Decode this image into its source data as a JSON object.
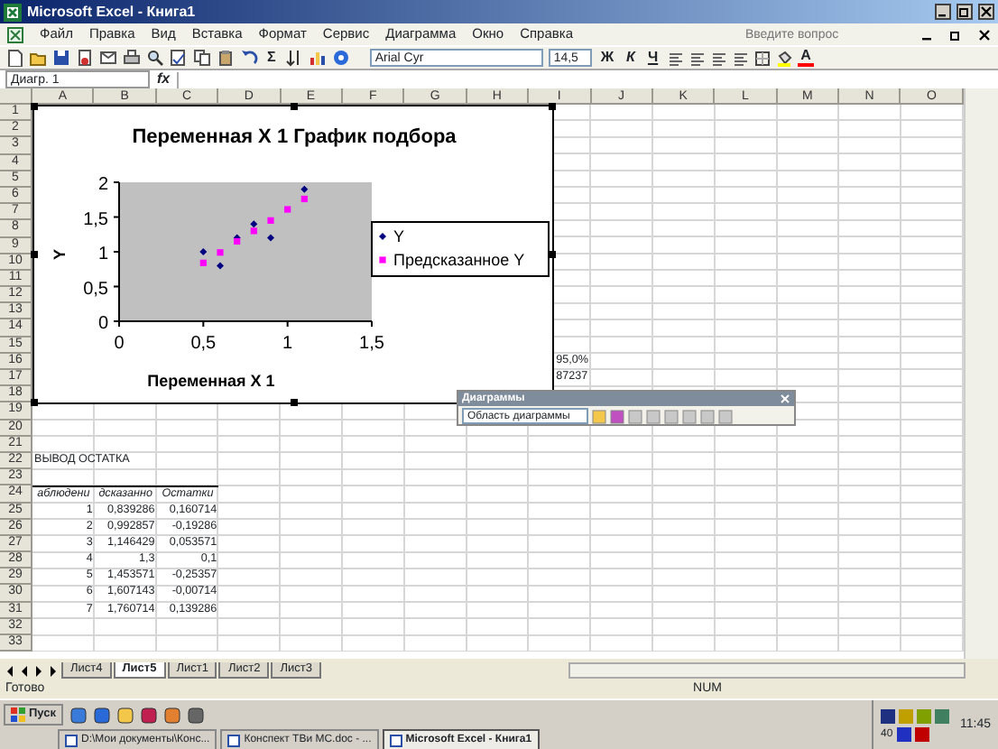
{
  "window": {
    "title": "Microsoft Excel - Книга1"
  },
  "menu": [
    {
      "label": "Файл"
    },
    {
      "label": "Правка"
    },
    {
      "label": "Вид"
    },
    {
      "label": "Вставка"
    },
    {
      "label": "Формат"
    },
    {
      "label": "Сервис"
    },
    {
      "label": "Диаграмма"
    },
    {
      "label": "Окно"
    },
    {
      "label": "Справка"
    }
  ],
  "help_search": {
    "placeholder": "Введите вопрос"
  },
  "toolbar": {
    "autosum": "Σ",
    "font": "Arial Cyr",
    "font_size": "14,5",
    "bold": "Ж",
    "italic": "К",
    "underline": "Ч",
    "font_color": "A"
  },
  "formula_bar": {
    "name_box": "Диагр. 1",
    "fx": "fx"
  },
  "sheet": {
    "columns": [
      "A",
      "B",
      "C",
      "D",
      "E",
      "F",
      "G",
      "H",
      "I",
      "J",
      "K",
      "L",
      "M",
      "N",
      "O"
    ],
    "rows": [
      {
        "label": "1",
        "cells": []
      },
      {
        "label": "2",
        "cells": []
      },
      {
        "label": "3",
        "cells": []
      },
      {
        "label": "4",
        "cells": []
      },
      {
        "label": "5",
        "cells": []
      },
      {
        "label": "6",
        "cells": []
      },
      {
        "label": "7",
        "cells": []
      },
      {
        "label": "8",
        "cells": []
      },
      {
        "label": "9",
        "cells": []
      },
      {
        "label": "10",
        "cells": []
      },
      {
        "label": "11",
        "cells": []
      },
      {
        "label": "12",
        "cells": []
      },
      {
        "label": "13",
        "cells": []
      },
      {
        "label": "14",
        "cells": []
      },
      {
        "label": "15",
        "cells": []
      },
      {
        "label": "16",
        "cells": []
      },
      {
        "label": "17",
        "cells": []
      },
      {
        "label": "18",
        "cells": []
      },
      {
        "label": "19",
        "cells": []
      },
      {
        "label": "20",
        "cells": []
      },
      {
        "label": "21",
        "cells": []
      },
      {
        "label": "22",
        "cells": [
          {
            "kind": "text",
            "text": "ВЫВОД ОСТАТКА"
          }
        ]
      },
      {
        "label": "23",
        "cells": []
      },
      {
        "label": "24",
        "cells": [
          {
            "kind": "header",
            "text": "аблюдени"
          },
          {
            "kind": "header",
            "text": "дсказанно"
          },
          {
            "kind": "header",
            "text": "Остатки"
          }
        ]
      },
      {
        "label": "25",
        "cells": [
          {
            "kind": "number",
            "text": "1"
          },
          {
            "kind": "number",
            "text": "0,839286"
          },
          {
            "kind": "number",
            "text": "0,160714"
          }
        ]
      },
      {
        "label": "26",
        "cells": [
          {
            "kind": "number",
            "text": "2"
          },
          {
            "kind": "number",
            "text": "0,992857"
          },
          {
            "kind": "number",
            "text": "-0,19286"
          }
        ]
      },
      {
        "label": "27",
        "cells": [
          {
            "kind": "number",
            "text": "3"
          },
          {
            "kind": "number",
            "text": "1,146429"
          },
          {
            "kind": "number",
            "text": "0,053571"
          }
        ]
      },
      {
        "label": "28",
        "cells": [
          {
            "kind": "number",
            "text": "4"
          },
          {
            "kind": "number",
            "text": "1,3"
          },
          {
            "kind": "number",
            "text": "0,1"
          }
        ]
      },
      {
        "label": "29",
        "cells": [
          {
            "kind": "number",
            "text": "5"
          },
          {
            "kind": "number",
            "text": "1,453571"
          },
          {
            "kind": "number",
            "text": "-0,25357"
          }
        ]
      },
      {
        "label": "30",
        "cells": [
          {
            "kind": "number",
            "text": "6"
          },
          {
            "kind": "number",
            "text": "1,607143"
          },
          {
            "kind": "number",
            "text": "-0,00714"
          }
        ]
      },
      {
        "label": "31",
        "cells": [
          {
            "kind": "number",
            "text": "7"
          },
          {
            "kind": "number",
            "text": "1,760714"
          },
          {
            "kind": "number",
            "text": "0,139286"
          }
        ]
      },
      {
        "label": "32",
        "cells": []
      },
      {
        "label": "33",
        "cells": []
      }
    ],
    "overlapped_cells": [
      {
        "text": "95,0%"
      },
      {
        "text": "87237"
      }
    ]
  },
  "chart": {
    "chart_data": {
      "type": "scatter",
      "title": "Переменная X 1 График подбора",
      "xlabel": "Переменная X 1",
      "ylabel": "Y",
      "legend": "right",
      "x": [
        0.5,
        0.6,
        0.7,
        0.8,
        0.9,
        1.0,
        1.1
      ],
      "xlim": [
        0,
        1.5
      ],
      "ylim": [
        0,
        2
      ],
      "xticks": [
        {
          "value": 0,
          "label": "0"
        },
        {
          "value": 0.5,
          "label": "0,5"
        },
        {
          "value": 1,
          "label": "1"
        },
        {
          "value": 1.5,
          "label": "1,5"
        }
      ],
      "yticks": [
        {
          "value": 0,
          "label": "0"
        },
        {
          "value": 0.5,
          "label": "0,5"
        },
        {
          "value": 1,
          "label": "1"
        },
        {
          "value": 1.5,
          "label": "1,5"
        },
        {
          "value": 2,
          "label": "2"
        }
      ],
      "series": [
        {
          "name": "Y",
          "color": "#000080",
          "marker": "diamond",
          "values": [
            1.0,
            0.8,
            1.2,
            1.4,
            1.2,
            null,
            1.9
          ]
        },
        {
          "name": "Предсказанное Y",
          "color": "#ff00ff",
          "marker": "square",
          "values": [
            0.84,
            0.99,
            1.15,
            1.3,
            1.45,
            1.61,
            1.76
          ]
        }
      ]
    }
  },
  "chart_toolbar": {
    "title": "Диаграммы",
    "object": "Область диаграммы"
  },
  "sheet_tabs": [
    {
      "label": "Лист4",
      "selected": false
    },
    {
      "label": "Лист5",
      "selected": true
    },
    {
      "label": "Лист1",
      "selected": false
    },
    {
      "label": "Лист2",
      "selected": false
    },
    {
      "label": "Лист3",
      "selected": false
    }
  ],
  "status_bar": {
    "status": "Готово",
    "indicator": "NUM"
  },
  "taskbar": {
    "start": "Пуск",
    "tasks": [
      {
        "label": "D:\\Мои документы\\Конс...",
        "selected": false
      },
      {
        "label": "Конспект ТВи МС.doc - ...",
        "selected": false
      },
      {
        "label": "Microsoft Excel - Книга1",
        "selected": true
      }
    ],
    "tray_text": "40",
    "clock": "11:45"
  }
}
